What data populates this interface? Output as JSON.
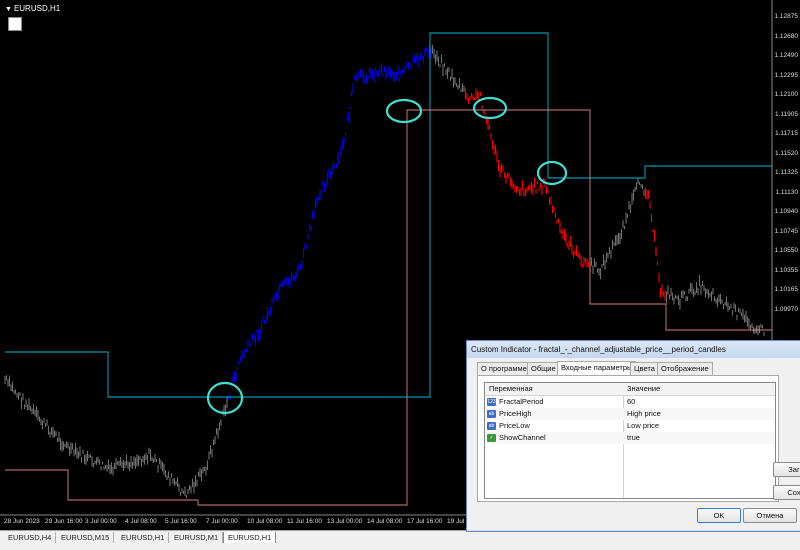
{
  "chart": {
    "symbol": "EURUSD,H1",
    "price_ticks": [
      "1.12875",
      "1.12680",
      "1.12490",
      "1.12295",
      "1.12100",
      "1.11905",
      "1.11715",
      "1.11520",
      "1.11325",
      "1.11130",
      "1.10940",
      "1.10745",
      "1.10550",
      "1.10355",
      "1.10165",
      "1.09970"
    ],
    "time_ticks": [
      "28 Jun 2023",
      "29 Jun 16:00",
      "3 Jul 00:00",
      "4 Jul 08:00",
      "5 Jul 16:00",
      "7 Jul 00:00",
      "10 Jul 08:00",
      "11 Jul 16:00",
      "13 Jul 00:00",
      "14 Jul 08:00",
      "17 Jul 16:00",
      "19 Jul"
    ],
    "colors": {
      "up_trend": "#0000ff",
      "down_trend": "#ff0000",
      "neutral": "#6f6f6f",
      "upper_channel": "#00bcd4",
      "lower_channel": "#d98080",
      "marker": "#40e0d0"
    }
  },
  "tabs": [
    "EURUSD,H4",
    "EURUSD,M15",
    "EURUSD,H1",
    "EURUSD,M1",
    "EURUSD,H1"
  ],
  "active_tab_index": 4,
  "dialog": {
    "title": "Custom Indicator - fractal_-_channel_adjustable_price__period_candles",
    "tabs": [
      "О программе",
      "Общие",
      "Входные параметры",
      "Цвета",
      "Отображение"
    ],
    "active_tab_index": 2,
    "grid_headers": {
      "variable": "Переменная",
      "value": "Значение"
    },
    "params": [
      {
        "name": "FractalPeriod",
        "value": "60",
        "icon": "int-icon"
      },
      {
        "name": "PriceHigh",
        "value": "High price",
        "icon": "enum-icon"
      },
      {
        "name": "PriceLow",
        "value": "Low price",
        "icon": "enum-icon"
      },
      {
        "name": "ShowChannel",
        "value": "true",
        "icon": "bool-icon"
      }
    ],
    "side_buttons": {
      "load": "Заг",
      "save": "Сох"
    },
    "ok_label": "OK",
    "cancel_label": "Отмена"
  }
}
